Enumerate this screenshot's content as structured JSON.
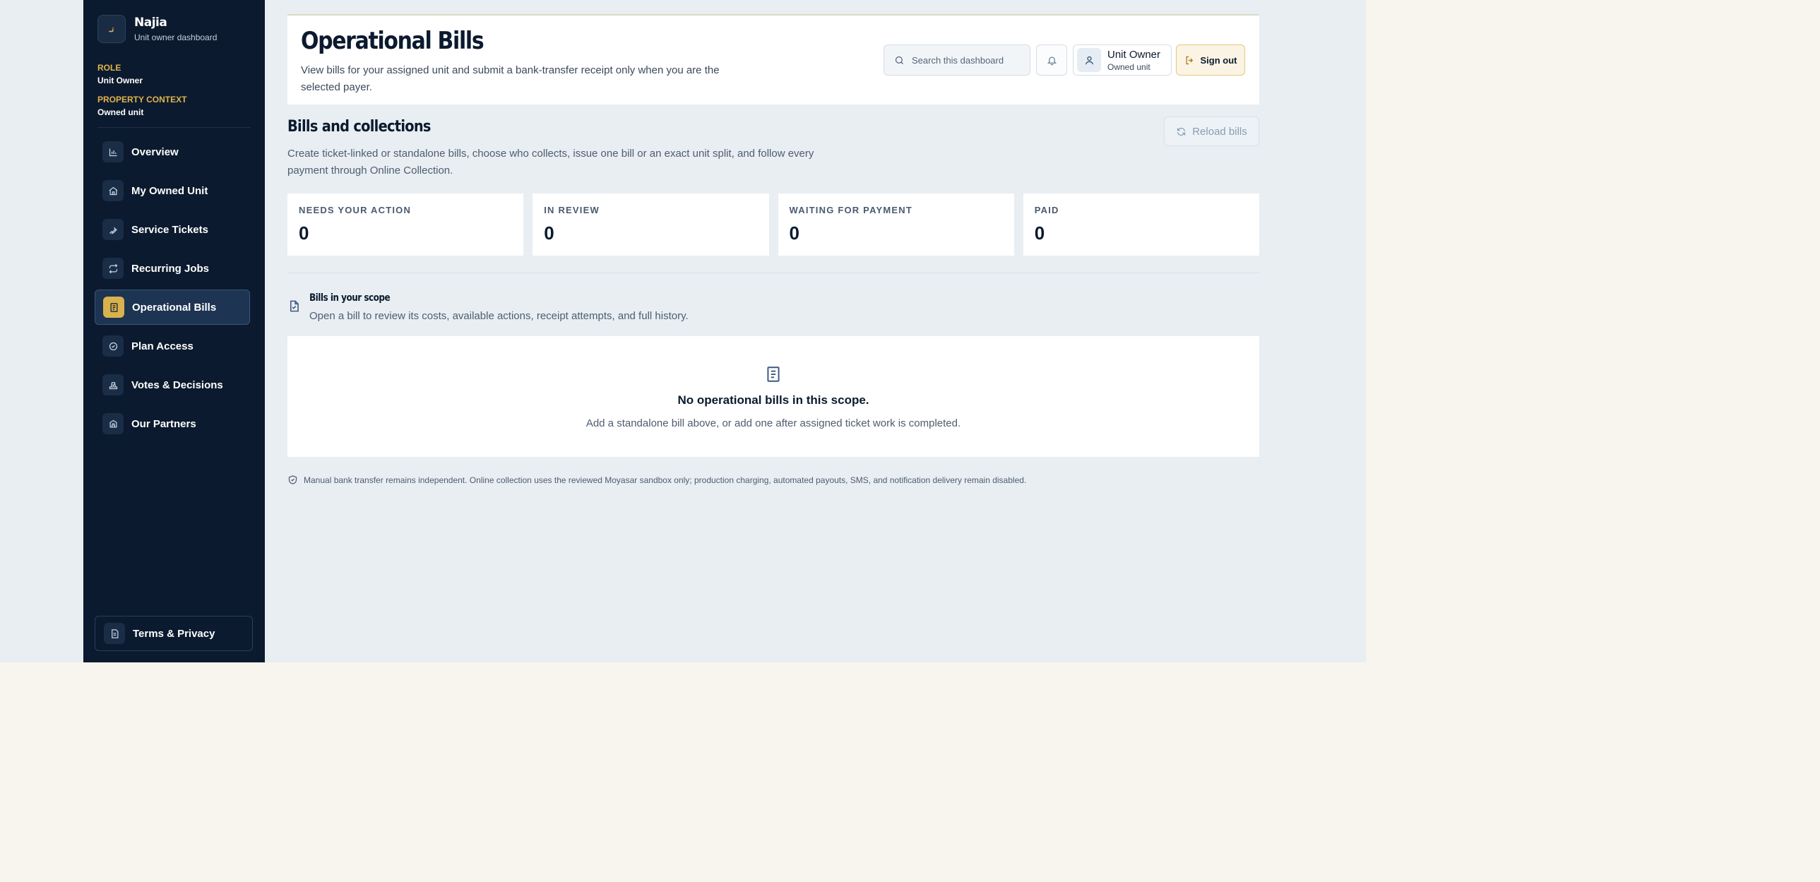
{
  "sidebar": {
    "brand": {
      "logo_text": "نـ",
      "name": "Najia",
      "subtitle": "Unit owner dashboard"
    },
    "context": [
      {
        "label": "ROLE",
        "value": "Unit Owner"
      },
      {
        "label": "PROPERTY CONTEXT",
        "value": "Owned unit"
      }
    ],
    "items": [
      {
        "label": "Overview",
        "icon": "bar-chart-icon",
        "active": false
      },
      {
        "label": "My Owned Unit",
        "icon": "home-icon",
        "active": false
      },
      {
        "label": "Service Tickets",
        "icon": "wrench-icon",
        "active": false
      },
      {
        "label": "Recurring Jobs",
        "icon": "repeat-icon",
        "active": false
      },
      {
        "label": "Operational Bills",
        "icon": "receipt-icon",
        "active": true
      },
      {
        "label": "Plan Access",
        "icon": "check-circle-icon",
        "active": false
      },
      {
        "label": "Votes & Decisions",
        "icon": "ballot-icon",
        "active": false
      },
      {
        "label": "Our Partners",
        "icon": "handshake-icon",
        "active": false
      }
    ],
    "footer": {
      "label": "Terms & Privacy",
      "icon": "document-icon"
    }
  },
  "header": {
    "title": "Operational Bills",
    "description": "View bills for your assigned unit and submit a bank-transfer receipt only when you are the selected payer.",
    "search_placeholder": "Search this dashboard",
    "user": {
      "name": "Unit Owner",
      "role": "Owned unit"
    },
    "signout_label": "Sign out"
  },
  "section": {
    "title": "Bills and collections",
    "description": "Create ticket-linked or standalone bills, choose who collects, issue one bill or an exact unit split, and follow every payment through Online Collection.",
    "reload_label": "Reload bills"
  },
  "stats": [
    {
      "label": "NEEDS YOUR ACTION",
      "value": "0"
    },
    {
      "label": "IN REVIEW",
      "value": "0"
    },
    {
      "label": "WAITING FOR PAYMENT",
      "value": "0"
    },
    {
      "label": "PAID",
      "value": "0"
    }
  ],
  "scope": {
    "title": "Bills in your scope",
    "description": "Open a bill to review its costs, available actions, receipt attempts, and full history."
  },
  "empty_state": {
    "title": "No operational bills in this scope.",
    "description": "Add a standalone bill above, or add one after assigned ticket work is completed."
  },
  "footnote": "Manual bank transfer remains independent. Online collection uses the reviewed Moyasar sandbox only; production charging, automated payouts, SMS, and notification delivery remain disabled.",
  "colors": {
    "sidebar_bg": "#0b1a2e",
    "accent_gold": "#d9b24e",
    "page_bg": "#e8eef2"
  }
}
